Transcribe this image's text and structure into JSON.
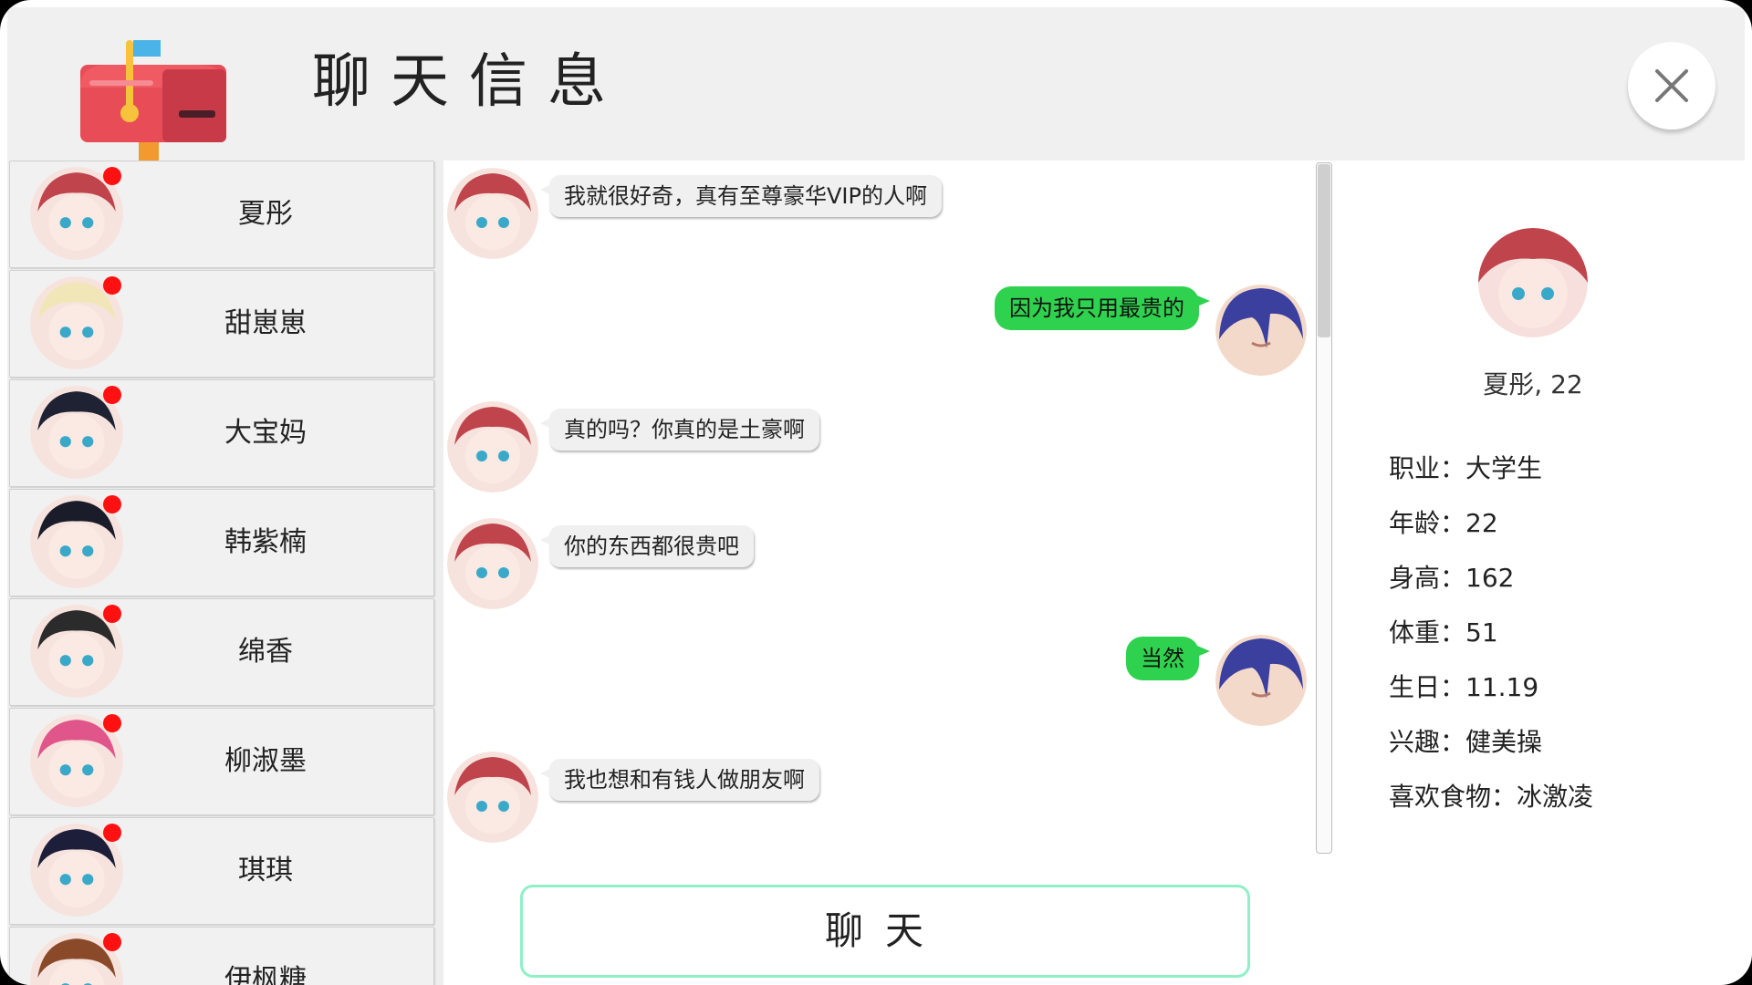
{
  "header": {
    "title": "聊天信息",
    "close_icon": "close-icon"
  },
  "contacts": [
    {
      "name": "夏彤",
      "unread": true,
      "color": "#c0444c"
    },
    {
      "name": "甜崽崽",
      "unread": true,
      "color": "#f1e6b8"
    },
    {
      "name": "大宝妈",
      "unread": true,
      "color": "#1f2233"
    },
    {
      "name": "韩紫楠",
      "unread": true,
      "color": "#1a1c2a"
    },
    {
      "name": "绵香",
      "unread": true,
      "color": "#2b2b2b"
    },
    {
      "name": "柳淑墨",
      "unread": true,
      "color": "#e0558a"
    },
    {
      "name": "琪琪",
      "unread": true,
      "color": "#1d1f3a"
    },
    {
      "name": "伊枫糖",
      "unread": true,
      "color": "#8a4a2a"
    }
  ],
  "messages": [
    {
      "from": "her",
      "text": "我就很好奇，真有至尊豪华VIP的人啊"
    },
    {
      "from": "me",
      "text": "因为我只用最贵的"
    },
    {
      "from": "her",
      "text": "真的吗？你真的是土豪啊"
    },
    {
      "from": "her",
      "text": "你的东西都很贵吧"
    },
    {
      "from": "me",
      "text": "当然"
    },
    {
      "from": "her",
      "text": "我也想和有钱人做朋友啊"
    }
  ],
  "chat_button": "聊天",
  "profile": {
    "header": "夏彤, 22",
    "fields": [
      {
        "label": "职业：",
        "value": "大学生"
      },
      {
        "label": "年龄：",
        "value": "22"
      },
      {
        "label": "身高：",
        "value": "162"
      },
      {
        "label": "体重：",
        "value": "51"
      },
      {
        "label": "生日：",
        "value": "11.19"
      },
      {
        "label": "兴趣：",
        "value": "健美操"
      },
      {
        "label": "喜欢食物：",
        "value": "冰激凌"
      }
    ]
  },
  "colors": {
    "unread_dot": "#ff1111",
    "outgoing_bubble": "#2fd24f",
    "button_border": "#8ff0c8",
    "header_bg": "#f0f0f0"
  }
}
